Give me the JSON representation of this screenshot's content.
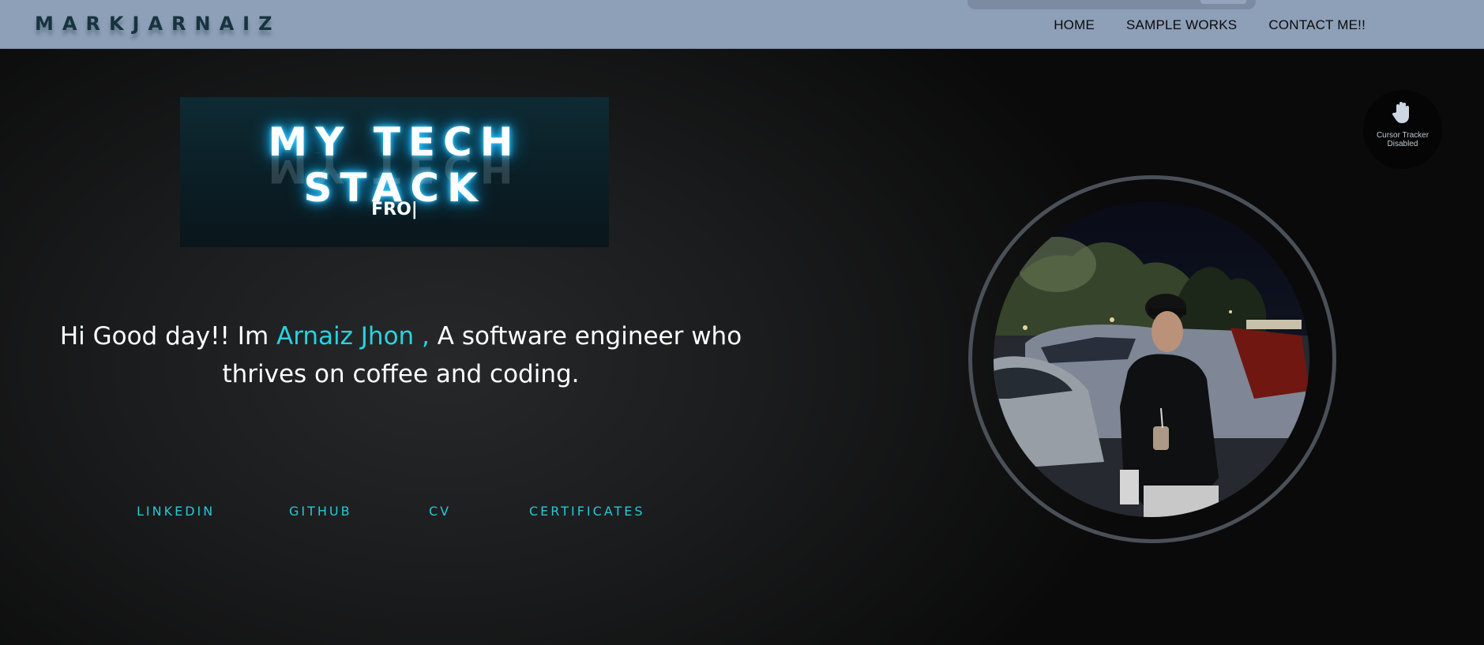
{
  "header": {
    "logo": "MARKJARNAIZ",
    "nav": [
      {
        "label": "HOME"
      },
      {
        "label": "SAMPLE WORKS"
      },
      {
        "label": "CONTACT ME!!"
      }
    ]
  },
  "stack": {
    "title": "MY TECH STACK",
    "typing": "FRO|"
  },
  "intro": {
    "prefix": "Hi Good day!! Im ",
    "name": "Arnaiz Jhon ,",
    "suffix": " A software engineer who thrives on coffee and coding."
  },
  "links": [
    {
      "label": "LINKEDIN"
    },
    {
      "label": "GITHUB"
    },
    {
      "label": "CV"
    },
    {
      "label": "CERTIFICATES"
    }
  ],
  "tracker": {
    "icon": "hand-icon",
    "line1": "Cursor Tracker",
    "line2": "Disabled"
  },
  "colors": {
    "header_bg": "#8e9fb8",
    "accent": "#28d3e2",
    "logo": "#17343e"
  }
}
